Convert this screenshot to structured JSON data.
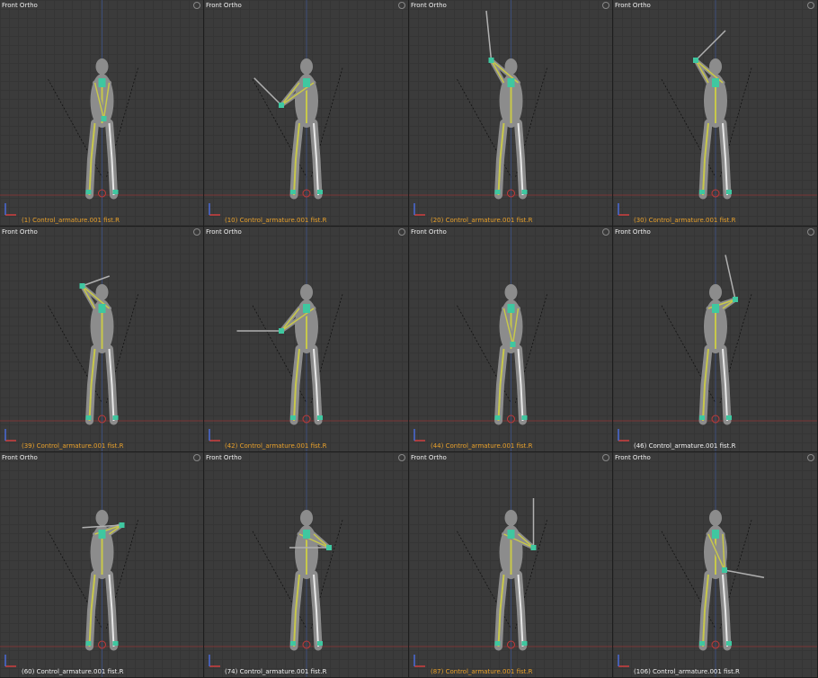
{
  "viewports": [
    {
      "title": "Front Ortho",
      "label": "(1) Control_armature.001 fist.R",
      "label_color": "#e8a02a"
    },
    {
      "title": "Front Ortho",
      "label": "(10) Control_armature.001 fist.R",
      "label_color": "#e8a02a"
    },
    {
      "title": "Front Ortho",
      "label": "(20) Control_armature.001 fist.R",
      "label_color": "#e8a02a"
    },
    {
      "title": "Front Ortho",
      "label": "(30) Control_armature.001 fist.R",
      "label_color": "#e8a02a"
    },
    {
      "title": "Front Ortho",
      "label": "(39) Control_armature.001 fist.R",
      "label_color": "#e8a02a"
    },
    {
      "title": "Front Ortho",
      "label": "(42) Control_armature.001 fist.R",
      "label_color": "#e8a02a"
    },
    {
      "title": "Front Ortho",
      "label": "(44) Control_armature.001 fist.R",
      "label_color": "#e8a02a"
    },
    {
      "title": "Front Ortho",
      "label": "(46) Control_armature.001 fist.R",
      "label_color": "#f0f0f0"
    },
    {
      "title": "Front Ortho",
      "label": "(60) Control_armature.001 fist.R",
      "label_color": "#f0f0f0"
    },
    {
      "title": "Front Ortho",
      "label": "(74) Control_armature.001 fist.R",
      "label_color": "#f0f0f0"
    },
    {
      "title": "Front Ortho",
      "label": "(87) Control_armature.001 fist.R",
      "label_color": "#e8a02a"
    },
    {
      "title": "Front Ortho",
      "label": "(106) Control_armature.001 fist.R",
      "label_color": "#f0f0f0"
    }
  ],
  "colors": {
    "bone": "#c8c84a",
    "body": "#8c8c8c",
    "control": "#3fc7a0",
    "club": "#b0b0b0"
  }
}
